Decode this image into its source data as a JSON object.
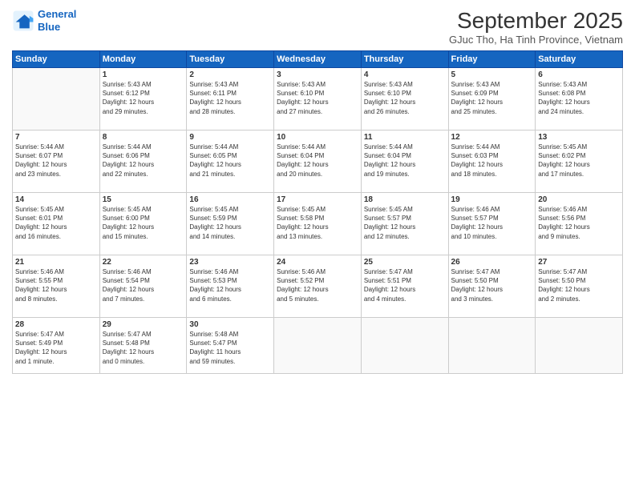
{
  "logo": {
    "line1": "General",
    "line2": "Blue"
  },
  "title": "September 2025",
  "subtitle": "GJuc Tho, Ha Tinh Province, Vietnam",
  "days_header": [
    "Sunday",
    "Monday",
    "Tuesday",
    "Wednesday",
    "Thursday",
    "Friday",
    "Saturday"
  ],
  "weeks": [
    [
      {
        "day": "",
        "info": ""
      },
      {
        "day": "1",
        "info": "Sunrise: 5:43 AM\nSunset: 6:12 PM\nDaylight: 12 hours\nand 29 minutes."
      },
      {
        "day": "2",
        "info": "Sunrise: 5:43 AM\nSunset: 6:11 PM\nDaylight: 12 hours\nand 28 minutes."
      },
      {
        "day": "3",
        "info": "Sunrise: 5:43 AM\nSunset: 6:10 PM\nDaylight: 12 hours\nand 27 minutes."
      },
      {
        "day": "4",
        "info": "Sunrise: 5:43 AM\nSunset: 6:10 PM\nDaylight: 12 hours\nand 26 minutes."
      },
      {
        "day": "5",
        "info": "Sunrise: 5:43 AM\nSunset: 6:09 PM\nDaylight: 12 hours\nand 25 minutes."
      },
      {
        "day": "6",
        "info": "Sunrise: 5:43 AM\nSunset: 6:08 PM\nDaylight: 12 hours\nand 24 minutes."
      }
    ],
    [
      {
        "day": "7",
        "info": "Sunrise: 5:44 AM\nSunset: 6:07 PM\nDaylight: 12 hours\nand 23 minutes."
      },
      {
        "day": "8",
        "info": "Sunrise: 5:44 AM\nSunset: 6:06 PM\nDaylight: 12 hours\nand 22 minutes."
      },
      {
        "day": "9",
        "info": "Sunrise: 5:44 AM\nSunset: 6:05 PM\nDaylight: 12 hours\nand 21 minutes."
      },
      {
        "day": "10",
        "info": "Sunrise: 5:44 AM\nSunset: 6:04 PM\nDaylight: 12 hours\nand 20 minutes."
      },
      {
        "day": "11",
        "info": "Sunrise: 5:44 AM\nSunset: 6:04 PM\nDaylight: 12 hours\nand 19 minutes."
      },
      {
        "day": "12",
        "info": "Sunrise: 5:44 AM\nSunset: 6:03 PM\nDaylight: 12 hours\nand 18 minutes."
      },
      {
        "day": "13",
        "info": "Sunrise: 5:45 AM\nSunset: 6:02 PM\nDaylight: 12 hours\nand 17 minutes."
      }
    ],
    [
      {
        "day": "14",
        "info": "Sunrise: 5:45 AM\nSunset: 6:01 PM\nDaylight: 12 hours\nand 16 minutes."
      },
      {
        "day": "15",
        "info": "Sunrise: 5:45 AM\nSunset: 6:00 PM\nDaylight: 12 hours\nand 15 minutes."
      },
      {
        "day": "16",
        "info": "Sunrise: 5:45 AM\nSunset: 5:59 PM\nDaylight: 12 hours\nand 14 minutes."
      },
      {
        "day": "17",
        "info": "Sunrise: 5:45 AM\nSunset: 5:58 PM\nDaylight: 12 hours\nand 13 minutes."
      },
      {
        "day": "18",
        "info": "Sunrise: 5:45 AM\nSunset: 5:57 PM\nDaylight: 12 hours\nand 12 minutes."
      },
      {
        "day": "19",
        "info": "Sunrise: 5:46 AM\nSunset: 5:57 PM\nDaylight: 12 hours\nand 10 minutes."
      },
      {
        "day": "20",
        "info": "Sunrise: 5:46 AM\nSunset: 5:56 PM\nDaylight: 12 hours\nand 9 minutes."
      }
    ],
    [
      {
        "day": "21",
        "info": "Sunrise: 5:46 AM\nSunset: 5:55 PM\nDaylight: 12 hours\nand 8 minutes."
      },
      {
        "day": "22",
        "info": "Sunrise: 5:46 AM\nSunset: 5:54 PM\nDaylight: 12 hours\nand 7 minutes."
      },
      {
        "day": "23",
        "info": "Sunrise: 5:46 AM\nSunset: 5:53 PM\nDaylight: 12 hours\nand 6 minutes."
      },
      {
        "day": "24",
        "info": "Sunrise: 5:46 AM\nSunset: 5:52 PM\nDaylight: 12 hours\nand 5 minutes."
      },
      {
        "day": "25",
        "info": "Sunrise: 5:47 AM\nSunset: 5:51 PM\nDaylight: 12 hours\nand 4 minutes."
      },
      {
        "day": "26",
        "info": "Sunrise: 5:47 AM\nSunset: 5:50 PM\nDaylight: 12 hours\nand 3 minutes."
      },
      {
        "day": "27",
        "info": "Sunrise: 5:47 AM\nSunset: 5:50 PM\nDaylight: 12 hours\nand 2 minutes."
      }
    ],
    [
      {
        "day": "28",
        "info": "Sunrise: 5:47 AM\nSunset: 5:49 PM\nDaylight: 12 hours\nand 1 minute."
      },
      {
        "day": "29",
        "info": "Sunrise: 5:47 AM\nSunset: 5:48 PM\nDaylight: 12 hours\nand 0 minutes."
      },
      {
        "day": "30",
        "info": "Sunrise: 5:48 AM\nSunset: 5:47 PM\nDaylight: 11 hours\nand 59 minutes."
      },
      {
        "day": "",
        "info": ""
      },
      {
        "day": "",
        "info": ""
      },
      {
        "day": "",
        "info": ""
      },
      {
        "day": "",
        "info": ""
      }
    ]
  ]
}
